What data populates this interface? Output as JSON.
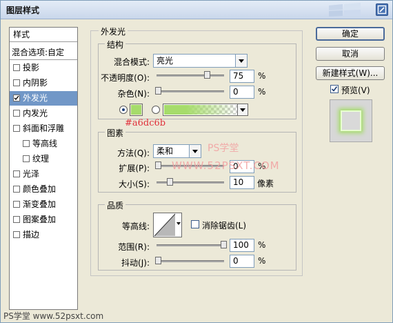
{
  "window": {
    "title": "图层样式"
  },
  "left_panel": {
    "header": "样式",
    "blend_options": "混合选项:自定",
    "items": [
      {
        "label": "投影",
        "checked": false,
        "selected": false,
        "indent": false
      },
      {
        "label": "内阴影",
        "checked": false,
        "selected": false,
        "indent": false
      },
      {
        "label": "外发光",
        "checked": true,
        "selected": true,
        "indent": false
      },
      {
        "label": "内发光",
        "checked": false,
        "selected": false,
        "indent": false
      },
      {
        "label": "斜面和浮雕",
        "checked": false,
        "selected": false,
        "indent": false
      },
      {
        "label": "等高线",
        "checked": false,
        "selected": false,
        "indent": true
      },
      {
        "label": "纹理",
        "checked": false,
        "selected": false,
        "indent": true
      },
      {
        "label": "光泽",
        "checked": false,
        "selected": false,
        "indent": false
      },
      {
        "label": "颜色叠加",
        "checked": false,
        "selected": false,
        "indent": false
      },
      {
        "label": "渐变叠加",
        "checked": false,
        "selected": false,
        "indent": false
      },
      {
        "label": "图案叠加",
        "checked": false,
        "selected": false,
        "indent": false
      },
      {
        "label": "描边",
        "checked": false,
        "selected": false,
        "indent": false
      }
    ]
  },
  "outer_glow": {
    "title": "外发光",
    "structure": {
      "title": "结构",
      "blend_mode_label": "混合模式:",
      "blend_mode": "亮光",
      "opacity_label": "不透明度(O):",
      "opacity": "75",
      "opacity_value": 75,
      "opacity_unit": "%",
      "noise_label": "杂色(N):",
      "noise": "0",
      "noise_value": 0,
      "noise_unit": "%",
      "color_hex": "#a6dc6b",
      "color_annotation": "#a6dc6b"
    },
    "elements": {
      "title": "图素",
      "technique_label": "方法(Q):",
      "technique": "柔和",
      "spread_label": "扩展(P):",
      "spread": "0",
      "spread_value": 0,
      "spread_unit": "%",
      "size_label": "大小(S):",
      "size": "10",
      "size_value": 10,
      "size_unit": "像素"
    },
    "quality": {
      "title": "品质",
      "contour_label": "等高线:",
      "anti_alias_label": "消除锯齿(L)",
      "anti_alias_checked": false,
      "range_label": "范围(R):",
      "range": "100",
      "range_value": 100,
      "range_unit": "%",
      "jitter_label": "抖动(J):",
      "jitter": "0",
      "jitter_value": 0,
      "jitter_unit": "%"
    }
  },
  "buttons": {
    "ok": "确定",
    "cancel": "取消",
    "new_style": "新建样式(W)...",
    "preview_label": "预览(V)",
    "preview_checked": true
  },
  "watermarks": {
    "ps_center": "PS学堂",
    "url_center": "WWW.52PSXT.COM",
    "bottom_left": "PS学堂 www.52psxt.com"
  },
  "colors": {
    "selection": "#7197c7",
    "glow": "#a6dc6b",
    "annotation": "#e0303a"
  }
}
